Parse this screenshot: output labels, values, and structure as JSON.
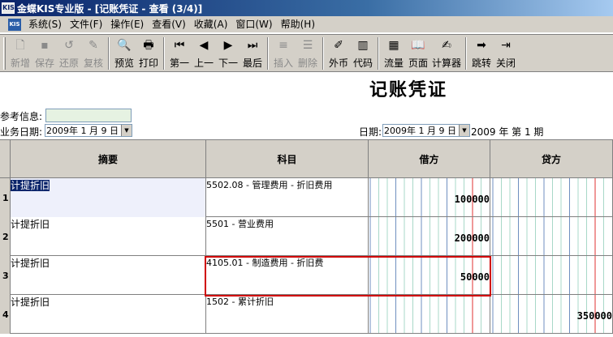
{
  "window": {
    "app_icon": "KIS",
    "title": "金蝶KIS专业版 - [记账凭证 - 查看 (3/4)]"
  },
  "menubar": {
    "mdi_icon": "KIS",
    "items": [
      "系统(S)",
      "文件(F)",
      "操作(E)",
      "查看(V)",
      "收藏(A)",
      "窗口(W)",
      "帮助(H)"
    ]
  },
  "toolbar": {
    "buttons": [
      {
        "label": "新增",
        "icon": "new-doc-icon",
        "glyph": "🗋",
        "enabled": false
      },
      {
        "label": "保存",
        "icon": "save-icon",
        "glyph": "▪",
        "enabled": false
      },
      {
        "label": "还原",
        "icon": "restore-icon",
        "glyph": "↺",
        "enabled": false
      },
      {
        "label": "复核",
        "icon": "review-icon",
        "glyph": "✎",
        "enabled": false
      },
      {
        "label": "预览",
        "icon": "preview-icon",
        "glyph": "🔍",
        "enabled": true
      },
      {
        "label": "打印",
        "icon": "print-icon",
        "glyph": "🖶",
        "enabled": true
      },
      {
        "label": "第一",
        "icon": "first-icon",
        "glyph": "⏮",
        "enabled": true
      },
      {
        "label": "上一",
        "icon": "prev-icon",
        "glyph": "◀",
        "enabled": true
      },
      {
        "label": "下一",
        "icon": "next-icon",
        "glyph": "▶",
        "enabled": true
      },
      {
        "label": "最后",
        "icon": "last-icon",
        "glyph": "⏭",
        "enabled": true
      },
      {
        "label": "插入",
        "icon": "insert-row-icon",
        "glyph": "≡",
        "enabled": false
      },
      {
        "label": "删除",
        "icon": "delete-row-icon",
        "glyph": "☰",
        "enabled": false
      },
      {
        "label": "外币",
        "icon": "currency-icon",
        "glyph": "✐",
        "enabled": true
      },
      {
        "label": "代码",
        "icon": "code-book-icon",
        "glyph": "▥",
        "enabled": true
      },
      {
        "label": "流量",
        "icon": "cashflow-icon",
        "glyph": "▦",
        "enabled": true
      },
      {
        "label": "页面",
        "icon": "page-icon",
        "glyph": "📖",
        "enabled": true
      },
      {
        "label": "计算器",
        "icon": "calculator-icon",
        "glyph": "✍",
        "enabled": true
      },
      {
        "label": "跳转",
        "icon": "jump-icon",
        "glyph": "➡",
        "enabled": true
      },
      {
        "label": "关闭",
        "icon": "close-door-icon",
        "glyph": "⇥",
        "enabled": true
      }
    ]
  },
  "form": {
    "title": "记账凭证",
    "ref_label": "参考信息:",
    "ref_value": "",
    "biz_date_label": "业务日期:",
    "biz_date_value": "2009年 1 月 9 日",
    "date_label": "日期:",
    "date_value": "2009年 1 月 9 日",
    "period_text": "2009 年 第 1 期"
  },
  "table": {
    "headers": {
      "summary": "摘要",
      "account": "科目",
      "debit": "借方",
      "credit": "贷方"
    },
    "rows": [
      {
        "num": "1",
        "summary": "计提折旧",
        "account": "5502.08 - 管理费用 - 折旧费用",
        "debit": "100000",
        "credit": ""
      },
      {
        "num": "2",
        "summary": "计提折旧",
        "account": "5501 - 营业费用",
        "debit": "200000",
        "credit": ""
      },
      {
        "num": "3",
        "summary": "计提折旧",
        "account": "4105.01 - 制造费用 - 折旧费",
        "debit": "50000",
        "credit": ""
      },
      {
        "num": "4",
        "summary": "计提折旧",
        "account": "1502 - 累计折旧",
        "debit": "",
        "credit": "350000"
      }
    ]
  },
  "colors": {
    "title_bar": "#0a246a",
    "highlight": "#d00000",
    "chrome": "#d4d0c8"
  }
}
